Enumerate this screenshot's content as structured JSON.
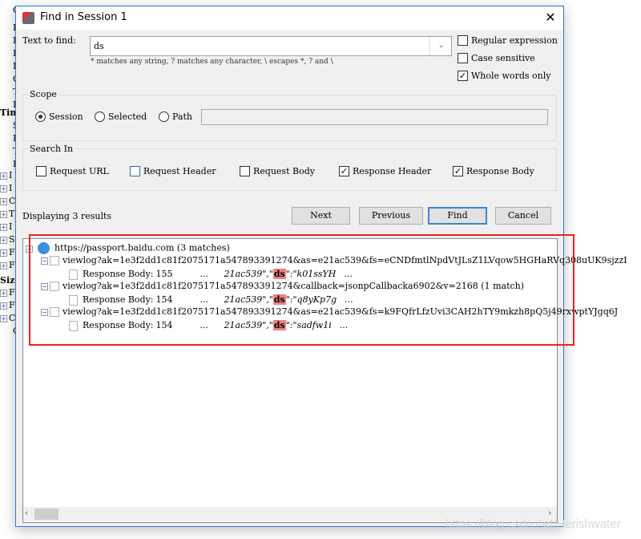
{
  "background_tree": {
    "fragments": [
      "C",
      "I",
      "F",
      "F",
      "I",
      "C",
      "T",
      "F",
      "Tim",
      "S",
      "F",
      "T",
      "F",
      "I",
      "I",
      "C",
      "T",
      "I",
      "S",
      "F",
      "F",
      "Siz",
      "F",
      "F",
      "C",
      "C"
    ]
  },
  "dialog": {
    "title": "Find in Session 1",
    "close_icon": "close-icon",
    "text_to_find_label": "Text to find:",
    "text_to_find_value": "ds",
    "hint": "* matches any string, ? matches any character, \\ escapes *, ? and \\",
    "options": [
      {
        "label": "Regular expression",
        "checked": false
      },
      {
        "label": "Case sensitive",
        "checked": false
      },
      {
        "label": "Whole words only",
        "checked": true
      }
    ],
    "scope": {
      "label": "Scope",
      "options": [
        {
          "label": "Session",
          "selected": true
        },
        {
          "label": "Selected",
          "selected": false
        },
        {
          "label": "Path",
          "selected": false
        }
      ],
      "path_value": ""
    },
    "search_in": {
      "label": "Search In",
      "options": [
        {
          "label": "Request URL",
          "checked": false
        },
        {
          "label": "Request Header",
          "checked": false
        },
        {
          "label": "Request Body",
          "checked": false
        },
        {
          "label": "Response Header",
          "checked": true
        },
        {
          "label": "Response Body",
          "checked": true
        }
      ]
    },
    "status": "Displaying 3 results",
    "buttons": {
      "next": "Next",
      "previous": "Previous",
      "find": "Find",
      "cancel": "Cancel"
    },
    "results": {
      "root": "https://passport.baidu.com (3 matches)",
      "items": [
        {
          "url": "viewlog?ak=1e3f2dd1c81f2075171a547893391274&as=e21ac539&fs=eCNDfmtlNpdVtJLsZ1LVqow5HGHaRVq308uUK9sjzzI",
          "body_label": "Response Body:",
          "body_size": "155",
          "pre": "...",
          "ctx_before": "21ac539\",\"",
          "match": "ds",
          "ctx_after": "\":\"k01ssYH",
          "post": "..."
        },
        {
          "url": "viewlog?ak=1e3f2dd1c81f2075171a547893391274&callback=jsonpCallbacka6902&v=2168 (1 match)",
          "body_label": "Response Body:",
          "body_size": "154",
          "pre": "...",
          "ctx_before": "21ac539\",\"",
          "match": "ds",
          "ctx_after": "\":\"q8yKp7g",
          "post": "..."
        },
        {
          "url": "viewlog?ak=1e3f2dd1c81f2075171a547893391274&as=e21ac539&fs=k9FQfrLfzUvi3CAH2hTY9mkzh8pQ5j49rxwptYJgq6J",
          "body_label": "Response Body:",
          "body_size": "154",
          "pre": "...",
          "ctx_before": "21ac539\",\"",
          "match": "ds",
          "ctx_after": "\":\"sadfw1i",
          "post": "..."
        }
      ]
    }
  },
  "watermark": "https://blog.csdn.net/Herishwater",
  "colors": {
    "highlight": "#f08080",
    "annotation_box": "#f02020",
    "accent": "#2b7bd6"
  }
}
